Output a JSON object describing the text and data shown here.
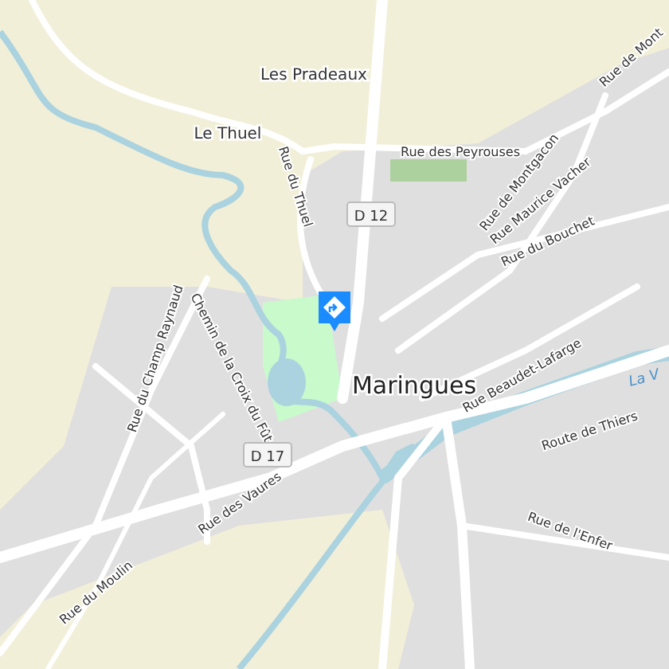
{
  "places": [
    {
      "label": "Les Pradeaux",
      "kind": "hamlet"
    },
    {
      "label": "Le Thuel",
      "kind": "hamlet"
    },
    {
      "label": "Maringues",
      "kind": "town"
    }
  ],
  "streets": [
    {
      "label": "Rue des Peyrouses"
    },
    {
      "label": "Rue du Thuel"
    },
    {
      "label": "Rue de Mont"
    },
    {
      "label": "Rue de Montgacon"
    },
    {
      "label": "Rue Maurice Vacher"
    },
    {
      "label": "Rue du Bouchet"
    },
    {
      "label": "Rue Beaudet-Lafarge"
    },
    {
      "label": "Route de Thiers"
    },
    {
      "label": "Rue de l'Enfer"
    },
    {
      "label": "Rue du Champ Raynaud"
    },
    {
      "label": "Chemin de la Croix du Fût"
    },
    {
      "label": "Rue des Vaures"
    },
    {
      "label": "Rue du Moulin"
    }
  ],
  "road_shields": [
    {
      "label": "D 12"
    },
    {
      "label": "D 17"
    }
  ],
  "water_labels": [
    {
      "label": "La V"
    }
  ]
}
